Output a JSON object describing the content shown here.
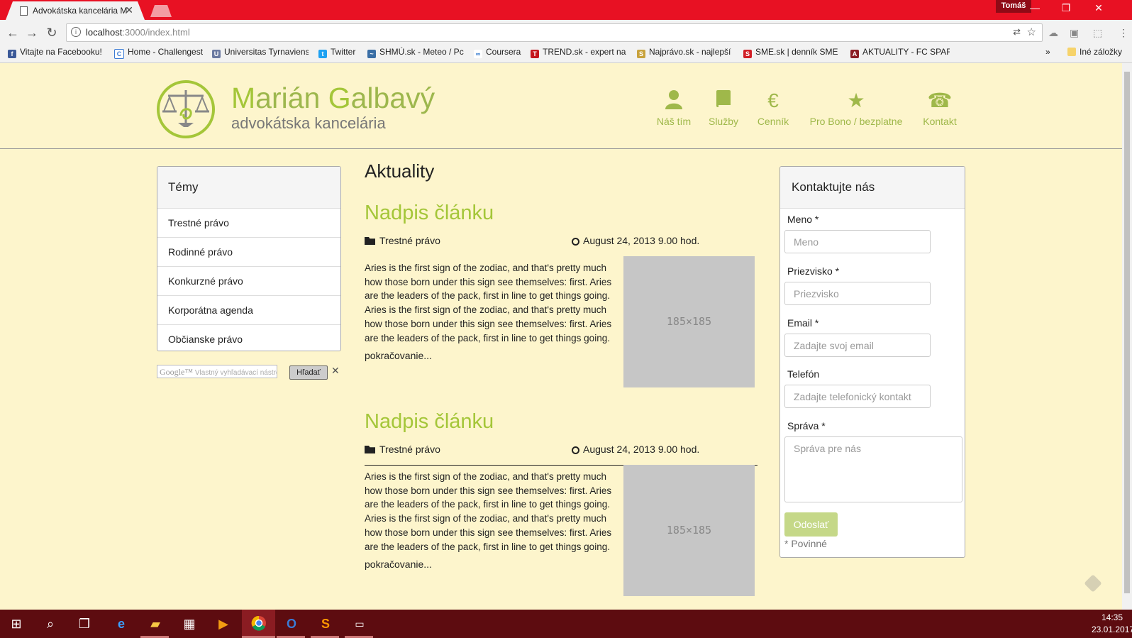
{
  "browser": {
    "tab_title": "Advokátska kancelária M",
    "user": "Tomáš",
    "url_host": "localhost",
    "url_rest": ":3000/index.html",
    "bookmarks": [
      {
        "label": "Vitajte na Facebooku!",
        "color": "#3b5998",
        "glyph": "f"
      },
      {
        "label": "Home - Challengest",
        "color": "#3b7bd4",
        "glyph": "C"
      },
      {
        "label": "Universitas Tyrnaviens",
        "color": "#6b7aa1",
        "glyph": "U"
      },
      {
        "label": "Twitter",
        "color": "#1da1f2",
        "glyph": "t"
      },
      {
        "label": "SHMÚ.sk - Meteo / Pc",
        "color": "#3a6ea5",
        "glyph": "~"
      },
      {
        "label": "Coursera",
        "color": "#2a73cc",
        "glyph": "∞"
      },
      {
        "label": "TREND.sk - expert na",
        "color": "#c4161c",
        "glyph": "T"
      },
      {
        "label": "Najprávo.sk - najlepší",
        "color": "#c8a23c",
        "glyph": "S"
      },
      {
        "label": "SME.sk | denník SME -",
        "color": "#d11f26",
        "glyph": "S"
      },
      {
        "label": "AKTUALITY - FC SPAR",
        "color": "#8b1d24",
        "glyph": "A"
      }
    ],
    "other_bookmarks": "Iné záložky"
  },
  "site": {
    "brand_name_1_cap": "M",
    "brand_name_1_rest": "arián ",
    "brand_name_2_cap": "G",
    "brand_name_2_rest": "albavý",
    "brand_sub": "advokátska kancelária",
    "nav": [
      {
        "label": "Náš tím",
        "icon": "user-icon",
        "glyph": "👤"
      },
      {
        "label": "Služby",
        "icon": "book-icon",
        "glyph": "▮"
      },
      {
        "label": "Cenník",
        "icon": "euro-icon",
        "glyph": "€"
      },
      {
        "label": "Pro Bono / bezplatne",
        "icon": "star-icon",
        "glyph": "★"
      },
      {
        "label": "Kontakt",
        "icon": "phone-icon",
        "glyph": "☎"
      }
    ]
  },
  "topics": {
    "title": "Témy",
    "items": [
      "Trestné právo",
      "Rodinné právo",
      "Konkurzné právo",
      "Korporátna agenda",
      "Občianske právo"
    ]
  },
  "search": {
    "google": "Google™",
    "placeholder": "Vlastný vyhľadávací nástroj",
    "button": "Hľadať",
    "close": "✕"
  },
  "news": {
    "title": "Aktuality",
    "articles": [
      {
        "title": "Nadpis článku",
        "category": "Trestné právo",
        "date": "August 24, 2013 9.00 hod.",
        "body": "Aries is the first sign of the zodiac, and that's pretty much how those born under this sign see themselves: first. Aries are the leaders of the pack, first in line to get things going. Aries is the first sign of the zodiac, and that's pretty much how those born under this sign see themselves: first. Aries are the leaders of the pack, first in line to get things going.",
        "more": "pokračovanie...",
        "image_label": "185×185"
      },
      {
        "title": "Nadpis článku",
        "category": "Trestné právo",
        "date": "August 24, 2013 9.00 hod.",
        "body": "Aries is the first sign of the zodiac, and that's pretty much how those born under this sign see themselves: first. Aries are the leaders of the pack, first in line to get things going. Aries is the first sign of the zodiac, and that's pretty much how those born under this sign see themselves: first. Aries are the leaders of the pack, first in line to get things going.",
        "more": "pokračovanie...",
        "image_label": "185×185"
      }
    ]
  },
  "contact": {
    "title": "Kontaktujte nás",
    "name_label": "Meno *",
    "name_placeholder": "Meno",
    "surname_label": "Priezvisko *",
    "surname_placeholder": "Priezvisko",
    "email_label": "Email *",
    "email_placeholder": "Zadajte svoj email",
    "phone_label": "Telefón",
    "phone_placeholder": "Zadajte telefonický kontakt",
    "message_label": "Správa *",
    "message_placeholder": "Správa pre nás",
    "send": "Odoslať",
    "required": "* Povinné"
  },
  "taskbar": {
    "time": "14:35",
    "date": "23.01.2017"
  },
  "colors": {
    "accent": "#a4c639",
    "page_bg": "#fdf5cc",
    "titlebar": "#e81123",
    "taskbar": "#5d0c10"
  }
}
